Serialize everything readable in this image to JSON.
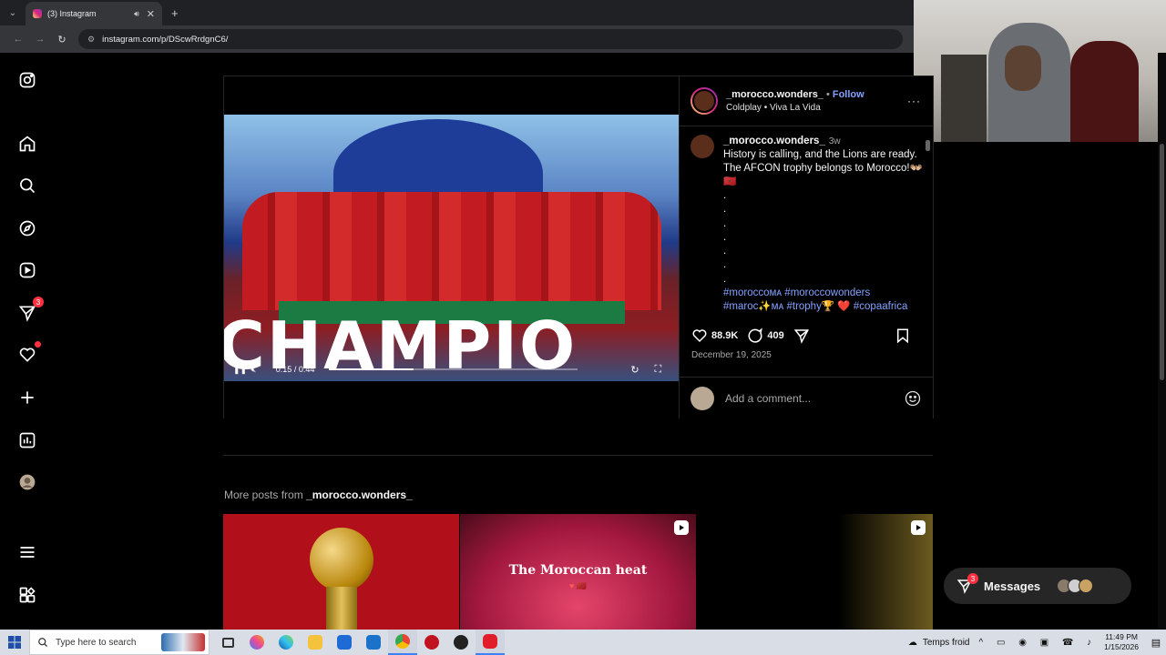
{
  "browser": {
    "tab_title": "(3) Instagram",
    "new_tab": "+",
    "url": "instagram.com/p/DScwRrdgnC6/"
  },
  "sidebar": {
    "create_badge": "3"
  },
  "video": {
    "overlay_text": "CHAMPIO",
    "time": "0:15 / 0:44",
    "progress": 0.34
  },
  "post": {
    "username": "_morocco.wonders_",
    "dot": "•",
    "follow": "Follow",
    "audio": "Coldplay • Viva La Vida",
    "more": "···",
    "caption_user": "_morocco.wonders_",
    "caption_age": "3w",
    "caption_text": "History is calling, and the Lions are ready. The AFCON trophy belongs to Morocco!👐🏼 🇲🇦",
    "caption_dots": [
      ".",
      ".",
      ".",
      ".",
      ".",
      ".",
      "."
    ],
    "hashtags_line1": "#moroccoᴍᴀ #moroccowonders",
    "hashtags_line2a": "#maroc✨ᴍᴀ #trophy🏆",
    "hashtags_line2_heart": "❤️",
    "hashtags_line2b": "#copaafrica",
    "likes": "88.9K",
    "comments": "409",
    "date": "December 19, 2025",
    "comment_placeholder": "Add a comment..."
  },
  "more_posts": {
    "prefix": "More posts from ",
    "username": "_morocco.wonders_",
    "tile2_text": "The Moroccan heat",
    "tile2_flags": "♥ 🇲🇦"
  },
  "messages": {
    "label": "Messages",
    "badge": "3"
  },
  "taskbar": {
    "search_placeholder": "Type here to search",
    "weather": "Temps froid",
    "time": "11:49 PM",
    "date": "1/15/2026"
  },
  "colors": {
    "accent": "#85a1ff",
    "notification": "#ff3040",
    "background": "#000000"
  }
}
